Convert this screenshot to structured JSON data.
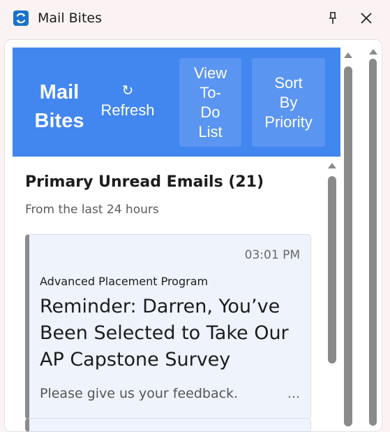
{
  "window": {
    "title": "Mail Bites",
    "app_icon": "refresh-app-icon",
    "pin_icon": "pin-icon",
    "close_icon": "close-icon"
  },
  "header": {
    "brand_line1": "Mail",
    "brand_line2": "Bites",
    "refresh_icon": "↻",
    "refresh_label": "Refresh",
    "todo_label_lines": [
      "View",
      "To-",
      "Do",
      "List"
    ],
    "sort_label_lines": [
      "Sort",
      "By",
      "Priority"
    ],
    "bg_color": "#4286f0",
    "button_color": "#5a95f1"
  },
  "section": {
    "title": "Primary Unread Emails (21)",
    "subtitle": "From the last 24 hours"
  },
  "emails": [
    {
      "time": "03:01 PM",
      "sender": "Advanced Placement Program",
      "subject": "Reminder: Darren, You’ve Been Selected to Take Our AP Capstone Survey",
      "preview": "Please give us your feedback.",
      "more": "..."
    }
  ]
}
